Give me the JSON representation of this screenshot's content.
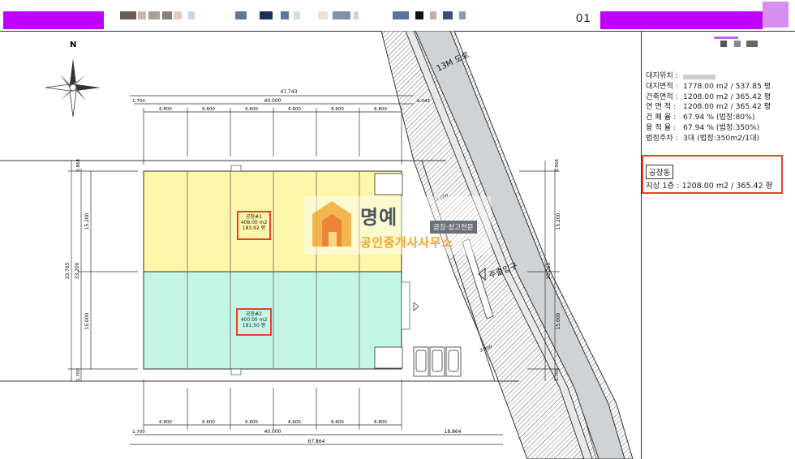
{
  "header": {
    "page_number": "01",
    "accent_color": "#c000ff"
  },
  "site_plan": {
    "road_label": "13M 도로",
    "entrance_label": "주출입구",
    "north_label": "N",
    "buildings": [
      {
        "name": "공장#1",
        "area_m2": "408.00  m2",
        "area_py": "183.92  평"
      },
      {
        "name": "공장#2",
        "area_m2": "400.00  m2",
        "area_py": "181.50  평"
      }
    ],
    "dims_top": {
      "overall": "47.743",
      "inner": "40.000",
      "left_offset": "1.700",
      "right_offset": "6.043",
      "spans": [
        "6.800",
        "6.600",
        "6.600",
        "6.600",
        "6.600",
        "6.800"
      ]
    },
    "dims_bottom": {
      "overall": "67.864",
      "inner": "40.000",
      "left_offset": "1.700",
      "right_offset": "18.864",
      "spans": [
        "6.800",
        "6.600",
        "6.600",
        "6.600",
        "6.600",
        "6.800"
      ]
    },
    "dims_left": {
      "overall": "33.765",
      "inner": "33.200",
      "top_offset": "0.868",
      "upper": "15.200",
      "lower": "15.000",
      "bottom_offset": "1.700"
    },
    "dims_right": {
      "overall": "33.265",
      "upper": "15.200",
      "lower": "15.000",
      "top_offset": "0.868",
      "bottom_offset": "1.700"
    },
    "setback_labels": [
      "3.000",
      "3.000"
    ]
  },
  "site_info": {
    "rows": [
      {
        "key": "대지위치 :",
        "value": ""
      },
      {
        "key": "대지면적 :",
        "value": "1778.00 m2 /   537.85  평"
      },
      {
        "key": "건축면적 :",
        "value": "1208.00 m2 /   365.42  평"
      },
      {
        "key": "연 면 적 :",
        "value": "1208.00 m2 /   365.42  평"
      },
      {
        "key": "건 폐 율 :",
        "value": "67.94 % (법정:80%)"
      },
      {
        "key": "용 적 율 :",
        "value": "67.94 % (법정:350%)"
      },
      {
        "key": "법정주차 :",
        "value": "3대 (법정:350m2/1대)"
      }
    ],
    "building_group": "공장동",
    "floor_row": "지상 1층 :   1208.00 m2 /   365.42  평"
  },
  "watermark": {
    "title": "명예",
    "subtitle": "공인중개사사무소",
    "tag": "공장·창고전문"
  }
}
